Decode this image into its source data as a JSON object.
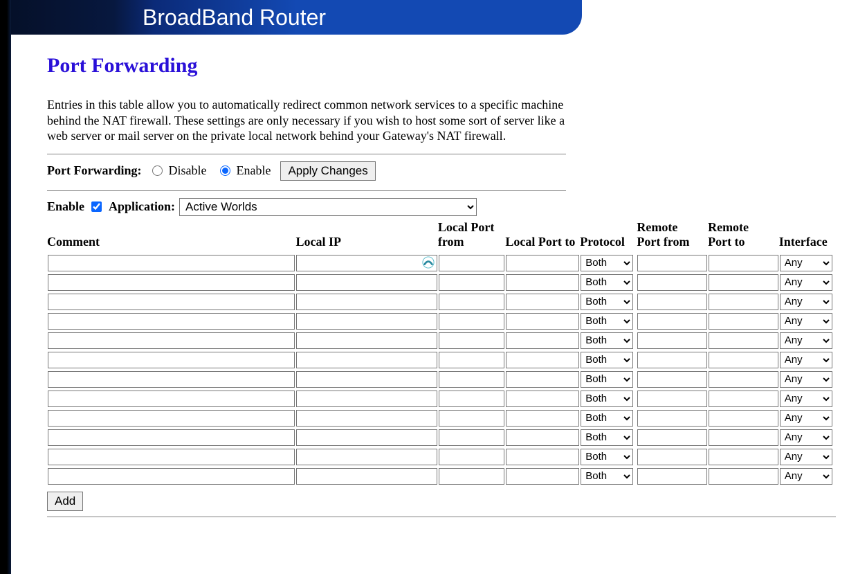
{
  "banner": {
    "title": "BroadBand Router"
  },
  "page": {
    "title": "Port Forwarding",
    "description": "Entries in this table allow you to automatically redirect common network services to a specific machine behind the NAT firewall. These settings are only necessary if you wish to host some sort of server like a web server or mail server on the private local network behind your Gateway's NAT firewall."
  },
  "toggle": {
    "label": "Port Forwarding:",
    "disable": "Disable",
    "enable": "Enable",
    "apply_button": "Apply Changes"
  },
  "entry": {
    "enable_label": "Enable",
    "application_label": "Application:",
    "application_selected": "Active Worlds"
  },
  "table": {
    "headers": {
      "comment": "Comment",
      "local_ip": "Local IP",
      "local_port_from": "Local Port from",
      "local_port_to": "Local Port to",
      "protocol": "Protocol",
      "remote_port_from": "Remote Port from",
      "remote_port_to": "Remote Port to",
      "interface": "Interface"
    },
    "protocol_options": [
      "Both"
    ],
    "interface_options": [
      "Any"
    ],
    "row_count": 12,
    "rows": [
      {
        "comment": "",
        "local_ip": "",
        "local_port_from": "",
        "local_port_to": "",
        "protocol": "Both",
        "remote_port_from": "",
        "remote_port_to": "",
        "interface": "Any",
        "badge": true
      },
      {
        "comment": "",
        "local_ip": "",
        "local_port_from": "",
        "local_port_to": "",
        "protocol": "Both",
        "remote_port_from": "",
        "remote_port_to": "",
        "interface": "Any"
      },
      {
        "comment": "",
        "local_ip": "",
        "local_port_from": "",
        "local_port_to": "",
        "protocol": "Both",
        "remote_port_from": "",
        "remote_port_to": "",
        "interface": "Any"
      },
      {
        "comment": "",
        "local_ip": "",
        "local_port_from": "",
        "local_port_to": "",
        "protocol": "Both",
        "remote_port_from": "",
        "remote_port_to": "",
        "interface": "Any"
      },
      {
        "comment": "",
        "local_ip": "",
        "local_port_from": "",
        "local_port_to": "",
        "protocol": "Both",
        "remote_port_from": "",
        "remote_port_to": "",
        "interface": "Any"
      },
      {
        "comment": "",
        "local_ip": "",
        "local_port_from": "",
        "local_port_to": "",
        "protocol": "Both",
        "remote_port_from": "",
        "remote_port_to": "",
        "interface": "Any"
      },
      {
        "comment": "",
        "local_ip": "",
        "local_port_from": "",
        "local_port_to": "",
        "protocol": "Both",
        "remote_port_from": "",
        "remote_port_to": "",
        "interface": "Any"
      },
      {
        "comment": "",
        "local_ip": "",
        "local_port_from": "",
        "local_port_to": "",
        "protocol": "Both",
        "remote_port_from": "",
        "remote_port_to": "",
        "interface": "Any"
      },
      {
        "comment": "",
        "local_ip": "",
        "local_port_from": "",
        "local_port_to": "",
        "protocol": "Both",
        "remote_port_from": "",
        "remote_port_to": "",
        "interface": "Any"
      },
      {
        "comment": "",
        "local_ip": "",
        "local_port_from": "",
        "local_port_to": "",
        "protocol": "Both",
        "remote_port_from": "",
        "remote_port_to": "",
        "interface": "Any"
      },
      {
        "comment": "",
        "local_ip": "",
        "local_port_from": "",
        "local_port_to": "",
        "protocol": "Both",
        "remote_port_from": "",
        "remote_port_to": "",
        "interface": "Any"
      },
      {
        "comment": "",
        "local_ip": "",
        "local_port_from": "",
        "local_port_to": "",
        "protocol": "Both",
        "remote_port_from": "",
        "remote_port_to": "",
        "interface": "Any"
      }
    ]
  },
  "buttons": {
    "add": "Add"
  },
  "icons": {
    "vpn_badge": "vpn-shield-icon"
  }
}
